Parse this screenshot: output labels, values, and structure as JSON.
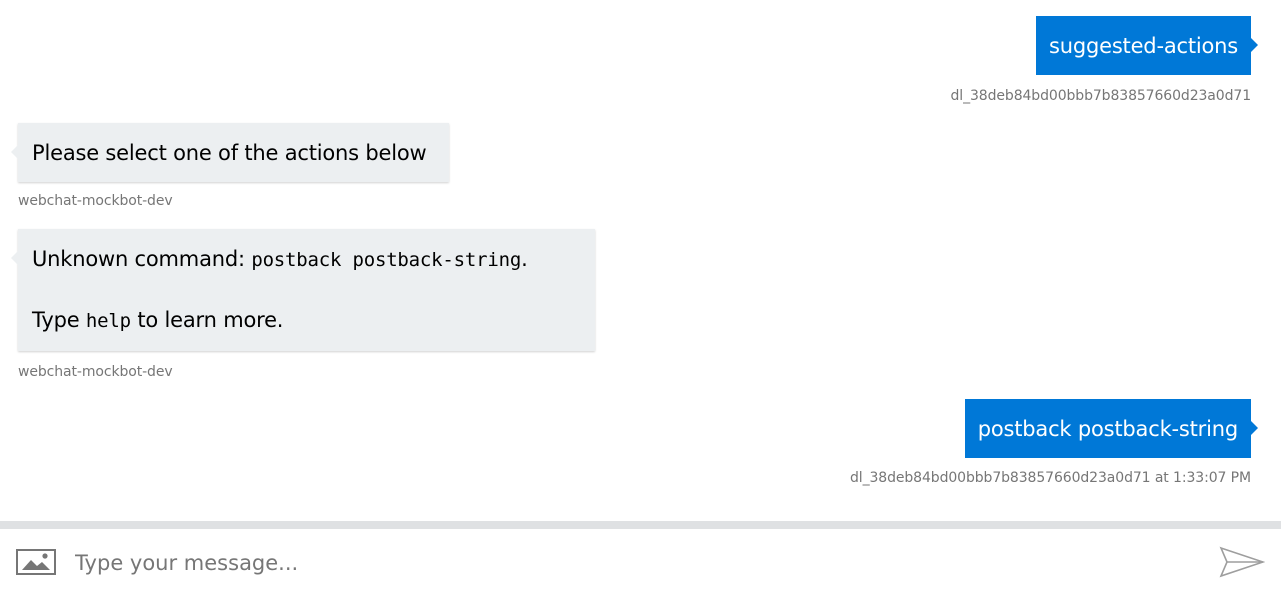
{
  "transcript": {
    "messages": [
      {
        "from": "user",
        "text": "suggested-actions",
        "meta": "dl_38deb84bd00bbb7b83857660d23a0d71"
      },
      {
        "from": "bot",
        "text": "Please select one of the actions below",
        "meta": "webchat-mockbot-dev"
      },
      {
        "from": "bot",
        "line1_prefix": "Unknown command: ",
        "line1_code": "postback postback-string",
        "line1_suffix": ".",
        "line2_prefix": "Type ",
        "line2_code": "help",
        "line2_suffix": " to learn more.",
        "meta": "webchat-mockbot-dev"
      },
      {
        "from": "user",
        "text": "postback postback-string",
        "meta": "dl_38deb84bd00bbb7b83857660d23a0d71 at 1:33:07 PM"
      }
    ]
  },
  "sendbox": {
    "placeholder": "Type your message...",
    "attach_icon": "image-upload-icon",
    "send_icon": "send-icon"
  },
  "colors": {
    "user_bubble": "#0078d7",
    "bot_bubble": "#eceff1",
    "meta_text": "#767676",
    "divider": "#dfe1e3"
  }
}
